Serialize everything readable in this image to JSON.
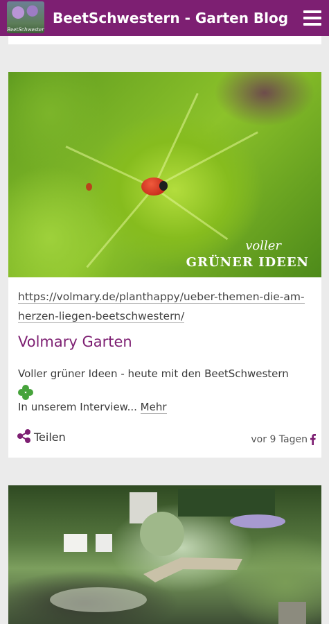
{
  "appbar": {
    "title": "BeetSchwestern - Garten Blog",
    "logo_text": "BeetSchwestern"
  },
  "post": {
    "image_overlay_line1": "voller",
    "image_overlay_line2": "GRÜNER IDEEN",
    "link": "https://volmary.de/planthappy/ueber-themen-die-am-herzen-liegen-beetschwestern/",
    "title": "Volmary Garten",
    "description": "Voller grüner Ideen - heute mit den BeetSchwestern",
    "excerpt": "In unserem Interview...",
    "more_label": "Mehr",
    "share_label": "Teilen",
    "time": "vor 9 Tagen",
    "source_icon": "facebook-icon"
  },
  "colors": {
    "brand": "#7d1f72",
    "title": "#7d1f72",
    "clover": "#46a33b"
  }
}
